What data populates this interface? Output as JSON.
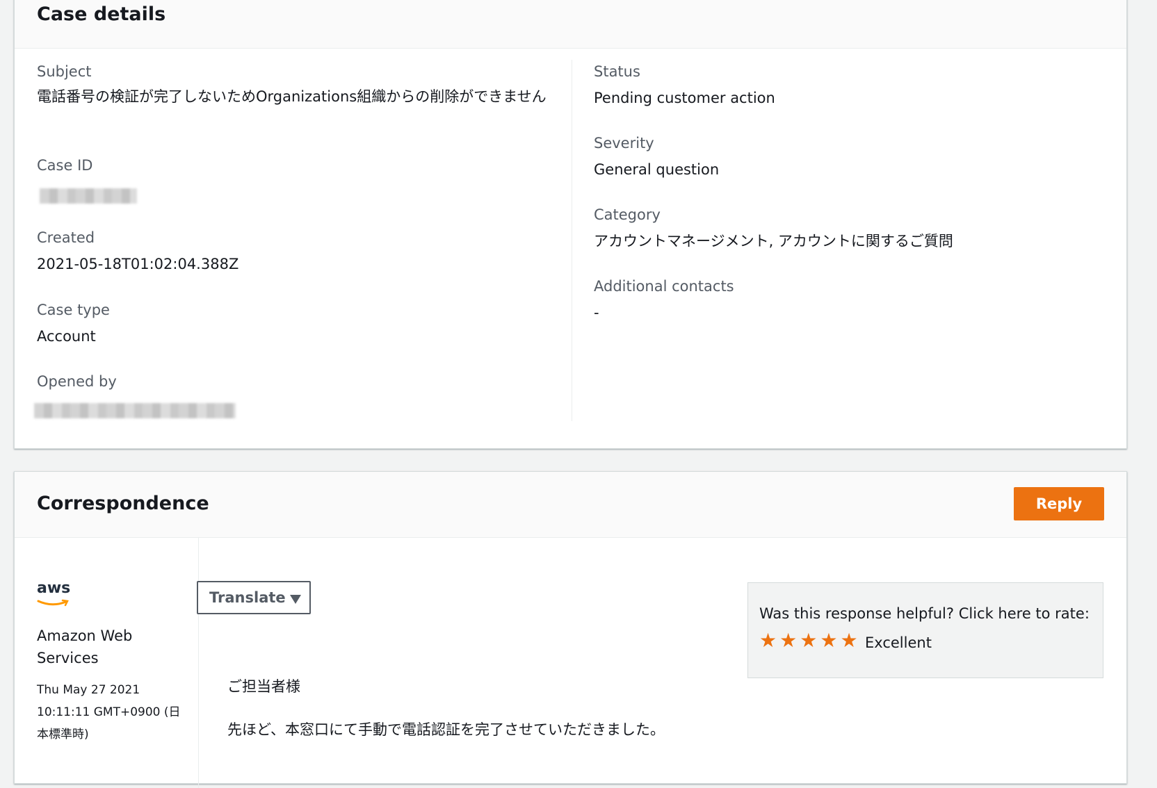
{
  "case_details": {
    "title": "Case details",
    "left": {
      "subject_label": "Subject",
      "subject_value": "電話番号の検証が完了しないためOrganizations組織からの削除ができません",
      "case_id_label": "Case ID",
      "created_label": "Created",
      "created_value": "2021-05-18T01:02:04.388Z",
      "case_type_label": "Case type",
      "case_type_value": "Account",
      "opened_by_label": "Opened by"
    },
    "right": {
      "status_label": "Status",
      "status_value": "Pending customer action",
      "severity_label": "Severity",
      "severity_value": "General question",
      "category_label": "Category",
      "category_value": "アカウントマネージメント, アカウントに関するご質問",
      "additional_contacts_label": "Additional contacts",
      "additional_contacts_value": "-"
    }
  },
  "correspondence": {
    "title": "Correspondence",
    "reply_label": "Reply",
    "sender": {
      "logo_text": "aws",
      "name": "Amazon Web Services",
      "timestamp": "Thu May 27 2021 10:11:11 GMT+0900 (日本標準時)"
    },
    "translate_label": "Translate",
    "rating": {
      "question": "Was this response helpful? Click here to rate:",
      "stars": 5,
      "label": "Excellent"
    },
    "message_lines": [
      "ご担当者様",
      "先ほど、本窓口にて手動で電話認証を完了させていただきました。"
    ]
  },
  "colors": {
    "accent": "#ec7211",
    "background": "#f2f3f3",
    "text": "#16191f",
    "label": "#545b64"
  }
}
